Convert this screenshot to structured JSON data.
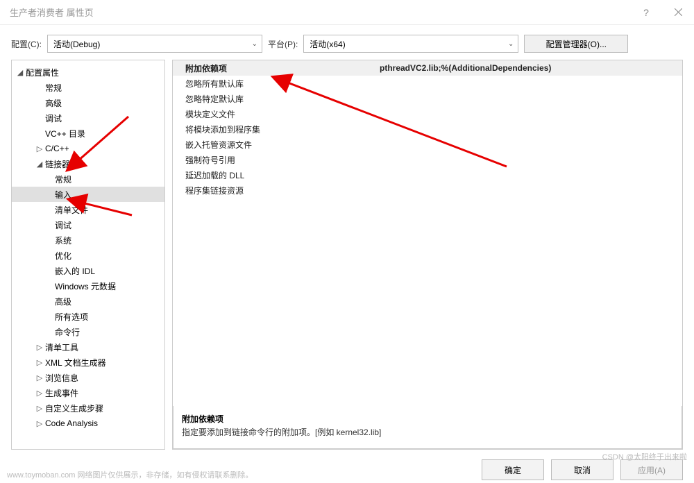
{
  "window": {
    "title": "生产者消费者 属性页",
    "help": "?"
  },
  "toolbar": {
    "config_label": "配置(C):",
    "config_value": "活动(Debug)",
    "platform_label": "平台(P):",
    "platform_value": "活动(x64)",
    "manager_btn": "配置管理器(O)..."
  },
  "tree": {
    "root": "配置属性",
    "items": [
      {
        "label": "常规",
        "indent": 2,
        "toggle": ""
      },
      {
        "label": "高级",
        "indent": 2,
        "toggle": ""
      },
      {
        "label": "调试",
        "indent": 2,
        "toggle": ""
      },
      {
        "label": "VC++ 目录",
        "indent": 2,
        "toggle": ""
      },
      {
        "label": "C/C++",
        "indent": 2,
        "toggle": "▷"
      },
      {
        "label": "链接器",
        "indent": 2,
        "toggle": "◢"
      },
      {
        "label": "常规",
        "indent": 3,
        "toggle": ""
      },
      {
        "label": "输入",
        "indent": 3,
        "toggle": "",
        "selected": true
      },
      {
        "label": "清单文件",
        "indent": 3,
        "toggle": ""
      },
      {
        "label": "调试",
        "indent": 3,
        "toggle": ""
      },
      {
        "label": "系统",
        "indent": 3,
        "toggle": ""
      },
      {
        "label": "优化",
        "indent": 3,
        "toggle": ""
      },
      {
        "label": "嵌入的 IDL",
        "indent": 3,
        "toggle": ""
      },
      {
        "label": "Windows 元数据",
        "indent": 3,
        "toggle": ""
      },
      {
        "label": "高级",
        "indent": 3,
        "toggle": ""
      },
      {
        "label": "所有选项",
        "indent": 3,
        "toggle": ""
      },
      {
        "label": "命令行",
        "indent": 3,
        "toggle": ""
      },
      {
        "label": "清单工具",
        "indent": 2,
        "toggle": "▷"
      },
      {
        "label": "XML 文档生成器",
        "indent": 2,
        "toggle": "▷"
      },
      {
        "label": "浏览信息",
        "indent": 2,
        "toggle": "▷"
      },
      {
        "label": "生成事件",
        "indent": 2,
        "toggle": "▷"
      },
      {
        "label": "自定义生成步骤",
        "indent": 2,
        "toggle": "▷"
      },
      {
        "label": "Code Analysis",
        "indent": 2,
        "toggle": "▷"
      }
    ]
  },
  "props": [
    {
      "key": "附加依赖项",
      "val": "pthreadVC2.lib;%(AdditionalDependencies)",
      "selected": true
    },
    {
      "key": "忽略所有默认库",
      "val": ""
    },
    {
      "key": "忽略特定默认库",
      "val": ""
    },
    {
      "key": "模块定义文件",
      "val": ""
    },
    {
      "key": "将模块添加到程序集",
      "val": ""
    },
    {
      "key": "嵌入托管资源文件",
      "val": ""
    },
    {
      "key": "强制符号引用",
      "val": ""
    },
    {
      "key": "延迟加载的 DLL",
      "val": ""
    },
    {
      "key": "程序集链接资源",
      "val": ""
    }
  ],
  "desc": {
    "title": "附加依赖项",
    "text": "指定要添加到链接命令行的附加项。[例如 kernel32.lib]"
  },
  "footer": {
    "ok": "确定",
    "cancel": "取消",
    "apply": "应用(A)"
  },
  "watermarks": {
    "left": "www.toymoban.com  网络图片仅供展示，非存储，如有侵权请联系删除。",
    "right": "CSDN @太阳终于出来啦"
  }
}
